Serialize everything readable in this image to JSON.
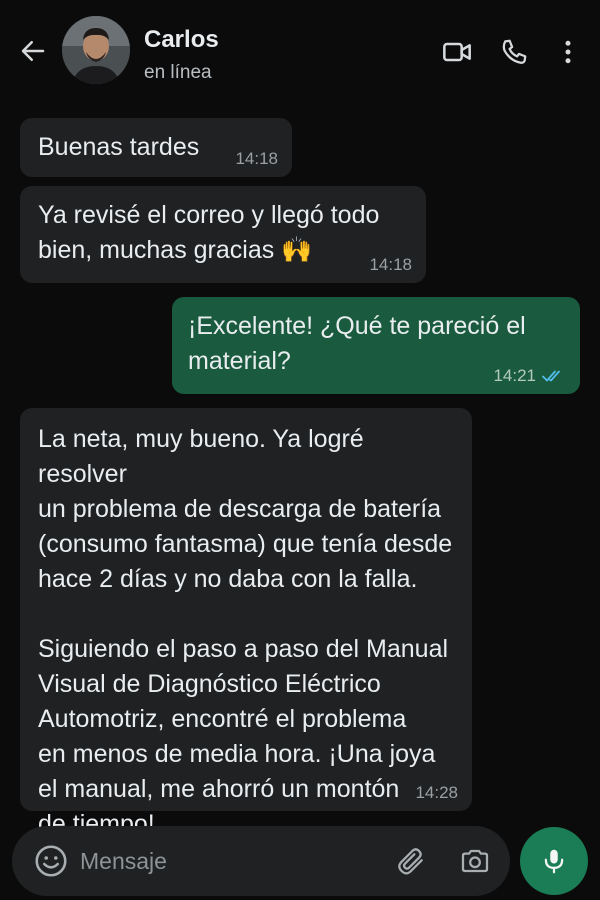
{
  "header": {
    "contact_name": "Carlos",
    "status": "en línea"
  },
  "messages": [
    {
      "direction": "in",
      "text": "Buenas tardes",
      "time": "14:18"
    },
    {
      "direction": "in",
      "text": "Ya revisé el correo y llegó todo\nbien, muchas gracias 🙌",
      "time": "14:18"
    },
    {
      "direction": "out",
      "text": "¡Excelente! ¿Qué te pareció el\nmaterial?",
      "time": "14:21",
      "read": true
    },
    {
      "direction": "in",
      "text": "La neta, muy bueno. Ya logré resolver\nun problema de descarga de batería\n(consumo fantasma) que tenía desde\nhace 2 días y no daba con la falla.\n\nSiguiendo el paso a paso del Manual\nVisual de Diagnóstico Eléctrico\nAutomotriz, encontré el problema\nen menos de media hora. ¡Una joya\nel manual, me ahorró un montón\nde tiempo!",
      "time": "14:28"
    }
  ],
  "composer": {
    "placeholder": "Mensaje"
  },
  "colors": {
    "background": "#0b0b0b",
    "incoming_bubble": "#1f2123",
    "outgoing_bubble": "#1a5b3f",
    "accent": "#1a7d55",
    "read_ticks": "#53bdeb"
  },
  "icons": [
    "back-arrow-icon",
    "video-call-icon",
    "phone-icon",
    "more-vert-icon",
    "emoji-icon",
    "paperclip-icon",
    "camera-icon",
    "mic-icon",
    "double-check-icon"
  ]
}
